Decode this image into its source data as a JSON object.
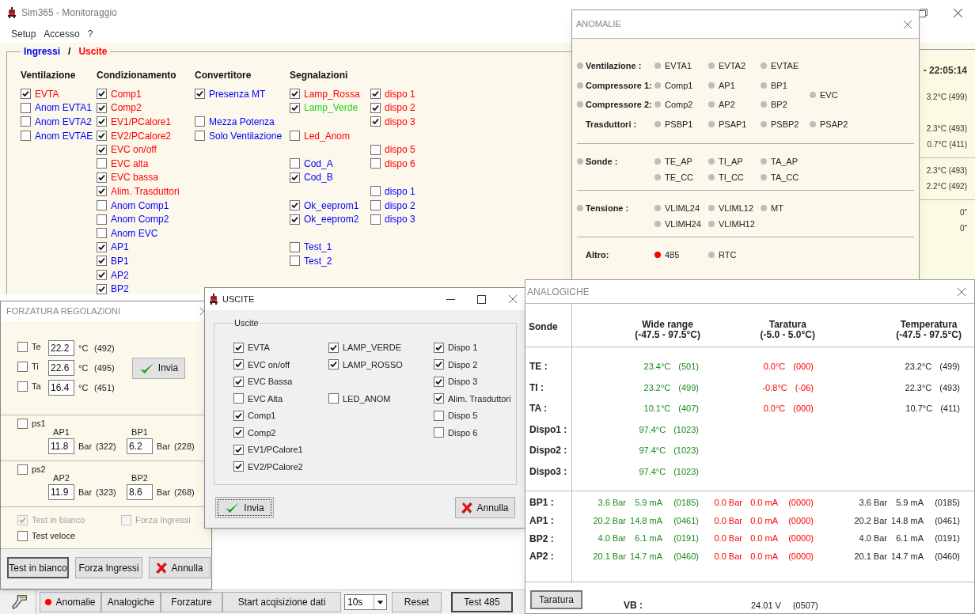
{
  "main": {
    "title": "Sim365 - Monitoraggio",
    "menu": [
      "Setup",
      "Accesso",
      "?"
    ],
    "legend": [
      {
        "label": "Ingressi",
        "color": "#0000ff"
      },
      {
        "label": "Uscite",
        "color": "#ff0000"
      }
    ],
    "legend_separator": "/",
    "groups": [
      {
        "title": "Ventilazione",
        "columns": [
          [
            {
              "kind": "check",
              "label": "EVTA",
              "checked": true,
              "color": "#ff0000"
            },
            {
              "kind": "check",
              "label": "Anom EVTA1",
              "checked": false,
              "color": "#0000ff"
            },
            {
              "kind": "check",
              "label": "Anom EVTA2",
              "checked": false,
              "color": "#0000ff"
            },
            {
              "kind": "check",
              "label": "Anom EVTAE",
              "checked": false,
              "color": "#0000ff"
            }
          ]
        ]
      },
      {
        "title": "Condizionamento",
        "columns": [
          [
            {
              "kind": "check",
              "label": "Comp1",
              "checked": true,
              "color": "#ff0000"
            },
            {
              "kind": "check",
              "label": "Comp2",
              "checked": true,
              "color": "#ff0000"
            },
            {
              "kind": "check",
              "label": "EV1/PCalore1",
              "checked": true,
              "color": "#ff0000"
            },
            {
              "kind": "check",
              "label": "EV2/PCalore2",
              "checked": true,
              "color": "#ff0000"
            },
            {
              "kind": "check",
              "label": "EVC on/off",
              "checked": true,
              "color": "#ff0000"
            },
            {
              "kind": "check",
              "label": "EVC alta",
              "checked": false,
              "color": "#ff0000"
            },
            {
              "kind": "check",
              "label": "EVC bassa",
              "checked": true,
              "color": "#ff0000"
            },
            {
              "kind": "check",
              "label": "Alim. Trasduttori",
              "checked": true,
              "color": "#ff0000"
            },
            {
              "kind": "check",
              "label": "Anom Comp1",
              "checked": false,
              "color": "#0000ff"
            },
            {
              "kind": "check",
              "label": "Anom Comp2",
              "checked": false,
              "color": "#0000ff"
            },
            {
              "kind": "check",
              "label": "Anom EVC",
              "checked": false,
              "color": "#0000ff"
            },
            {
              "kind": "check",
              "label": "AP1",
              "checked": true,
              "color": "#0000ff"
            },
            {
              "kind": "check",
              "label": "BP1",
              "checked": true,
              "color": "#0000ff"
            },
            {
              "kind": "check",
              "label": "AP2",
              "checked": true,
              "color": "#0000ff"
            },
            {
              "kind": "check",
              "label": "BP2",
              "checked": true,
              "color": "#0000ff"
            }
          ]
        ]
      },
      {
        "title": "Convertitore",
        "columns": [
          [
            {
              "kind": "check",
              "label": "Presenza MT",
              "checked": true,
              "color": "#0000ff"
            },
            {
              "kind": "gap"
            },
            {
              "kind": "check",
              "label": "Mezza Potenza",
              "checked": false,
              "color": "#0000ff"
            },
            {
              "kind": "check",
              "label": "Solo Ventilazione",
              "checked": false,
              "color": "#0000ff"
            }
          ]
        ]
      },
      {
        "title": "Segnalazioni",
        "columns": [
          [
            {
              "kind": "check",
              "label": "Lamp_Rossa",
              "checked": true,
              "color": "#ff0000"
            },
            {
              "kind": "check",
              "label": "Lamp_Verde",
              "checked": true,
              "color": "#19d219"
            },
            {
              "kind": "gap"
            },
            {
              "kind": "check",
              "label": "Led_Anom",
              "checked": false,
              "color": "#ff0000"
            },
            {
              "kind": "gap"
            },
            {
              "kind": "check",
              "label": "Cod_A",
              "checked": false,
              "color": "#0000ff"
            },
            {
              "kind": "check",
              "label": "Cod_B",
              "checked": true,
              "color": "#0000ff"
            },
            {
              "kind": "gap"
            },
            {
              "kind": "check",
              "label": "Ok_eeprom1",
              "checked": true,
              "color": "#0000ff"
            },
            {
              "kind": "check",
              "label": "Ok_eeprom2",
              "checked": true,
              "color": "#0000ff"
            },
            {
              "kind": "gap"
            },
            {
              "kind": "check",
              "label": "Test_1",
              "checked": false,
              "color": "#0000ff"
            },
            {
              "kind": "check",
              "label": "Test_2",
              "checked": false,
              "color": "#0000ff"
            }
          ],
          [
            {
              "kind": "check",
              "label": "dispo 1",
              "checked": true,
              "color": "#ff0000"
            },
            {
              "kind": "check",
              "label": "dispo 2",
              "checked": true,
              "color": "#ff0000"
            },
            {
              "kind": "check",
              "label": "dispo 3",
              "checked": true,
              "color": "#ff0000"
            },
            {
              "kind": "gap"
            },
            {
              "kind": "check",
              "label": "dispo 5",
              "checked": false,
              "color": "#ff0000"
            },
            {
              "kind": "check",
              "label": "dispo 6",
              "checked": false,
              "color": "#ff0000"
            },
            {
              "kind": "gap"
            },
            {
              "kind": "check",
              "label": "dispo 1",
              "checked": false,
              "color": "#0000ff"
            },
            {
              "kind": "check",
              "label": "dispo 2",
              "checked": false,
              "color": "#0000ff"
            },
            {
              "kind": "check",
              "label": "dispo 3",
              "checked": false,
              "color": "#0000ff"
            }
          ]
        ]
      }
    ],
    "side_readings": [
      [
        "- 22:05:14"
      ],
      [
        "3.2°C  (499)"
      ],
      [
        "2.3°C  (493)",
        "0.7°C  (411)"
      ],
      [
        "2.3°C  (493)",
        "2.2°C  (492)"
      ],
      [
        "0\"",
        "0\""
      ]
    ],
    "toolbar": [
      {
        "kind": "button",
        "label": "Anomalie",
        "alarm": true,
        "default": false
      },
      {
        "kind": "button",
        "label": "Analogiche",
        "alarm": false,
        "default": false
      },
      {
        "kind": "button",
        "label": "Forzature",
        "alarm": false,
        "default": false
      },
      {
        "kind": "button",
        "label": "Start acqisizione dati",
        "alarm": false,
        "default": false
      },
      {
        "kind": "select",
        "value": "10s"
      },
      {
        "kind": "button",
        "label": "Reset",
        "alarm": false,
        "default": false
      },
      {
        "kind": "button",
        "label": "Test 485",
        "alarm": false,
        "default": true
      }
    ]
  },
  "forzatura": {
    "title": "FORZATURA REGOLAZIONI",
    "temps": [
      {
        "label": "Te",
        "checked": false,
        "value": "22.2",
        "unit": "°C",
        "raw": "(492)"
      },
      {
        "label": "Ti",
        "checked": false,
        "value": "22.6",
        "unit": "°C",
        "raw": "(495)"
      },
      {
        "label": "Ta",
        "checked": false,
        "value": "16.4",
        "unit": "°C",
        "raw": "(451)"
      }
    ],
    "send_button": "Invia",
    "pressures": [
      {
        "label": "ps1",
        "checked": false,
        "fields": [
          {
            "caption": "AP1",
            "value": "11.8",
            "unit": "Bar",
            "raw": "(322)"
          },
          {
            "caption": "BP1",
            "value": "6.2",
            "unit": "Bar",
            "raw": "(228)"
          }
        ]
      },
      {
        "label": "ps2",
        "checked": false,
        "fields": [
          {
            "caption": "AP2",
            "value": "11.9",
            "unit": "Bar",
            "raw": "(323)"
          },
          {
            "caption": "BP2",
            "value": "8.6",
            "unit": "Bar",
            "raw": "(268)"
          }
        ]
      }
    ],
    "options": [
      {
        "label": "Test in bianco",
        "checked": true,
        "disabled": true
      },
      {
        "label": "Forza Ingressi",
        "checked": false,
        "disabled": true
      },
      {
        "label": "Test veloce",
        "checked": false,
        "disabled": false
      }
    ],
    "buttons": [
      {
        "label": "Test in bianco",
        "kind": "plain",
        "default": true
      },
      {
        "label": "Forza Ingressi",
        "kind": "plain",
        "default": false
      },
      {
        "label": "Annulla",
        "kind": "cancel",
        "default": false
      }
    ]
  },
  "uscite": {
    "title": "USCITE",
    "group_label": "Uscite",
    "columns": [
      [
        {
          "kind": "check",
          "label": "EVTA",
          "checked": true
        },
        {
          "kind": "check",
          "label": "EVC on/off",
          "checked": true
        },
        {
          "kind": "check",
          "label": "EVC Bassa",
          "checked": true
        },
        {
          "kind": "check",
          "label": "EVC Alta",
          "checked": false
        },
        {
          "kind": "check",
          "label": "Comp1",
          "checked": true
        },
        {
          "kind": "check",
          "label": "Comp2",
          "checked": true
        },
        {
          "kind": "check",
          "label": "EV1/PCalore1",
          "checked": true
        },
        {
          "kind": "check",
          "label": "EV2/PCalore2",
          "checked": true
        }
      ],
      [
        {
          "kind": "check",
          "label": "LAMP_VERDE",
          "checked": true
        },
        {
          "kind": "check",
          "label": "LAMP_ROSSO",
          "checked": true
        },
        {
          "kind": "gap"
        },
        {
          "kind": "check",
          "label": "LED_ANOM",
          "checked": false
        }
      ],
      [
        {
          "kind": "check",
          "label": "Dispo 1",
          "checked": true
        },
        {
          "kind": "check",
          "label": "Dispo 2",
          "checked": true
        },
        {
          "kind": "check",
          "label": "Dispo 3",
          "checked": true
        },
        {
          "kind": "check",
          "label": "Alim. Trasduttori",
          "checked": true
        },
        {
          "kind": "check",
          "label": "Dispo 5",
          "checked": false
        },
        {
          "kind": "check",
          "label": "Dispo 6",
          "checked": false
        }
      ]
    ],
    "buttons": [
      {
        "label": "Invia",
        "kind": "ok"
      },
      {
        "label": "Annulla",
        "kind": "cancel"
      }
    ]
  },
  "anomalie": {
    "title": "ANOMALIE",
    "sections": [
      {
        "rows": [
          {
            "label": "Ventilazione :",
            "led": true,
            "items": [
              {
                "label": "EVTA1",
                "alarm": false
              },
              {
                "label": "EVTA2",
                "alarm": false
              },
              {
                "label": "EVTAE",
                "alarm": false
              }
            ]
          },
          {
            "label": "Compressore 1:",
            "led": true,
            "items": [
              {
                "label": "Comp1",
                "alarm": false
              },
              {
                "label": "AP1",
                "alarm": false
              },
              {
                "label": "BP1",
                "alarm": false
              },
              {
                "label": "EVC",
                "alarm": false,
                "spans_rows": true
              }
            ]
          },
          {
            "label": "Compressore 2:",
            "led": true,
            "items": [
              {
                "label": "Comp2",
                "alarm": false
              },
              {
                "label": "AP2",
                "alarm": false
              },
              {
                "label": "BP2",
                "alarm": false
              }
            ]
          },
          {
            "label": "Trasduttori :",
            "led": false,
            "items": [
              {
                "label": "PSBP1",
                "alarm": false
              },
              {
                "label": "PSAP1",
                "alarm": false
              },
              {
                "label": "PSBP2",
                "alarm": false
              },
              {
                "label": "PSAP2",
                "alarm": false
              }
            ]
          }
        ]
      },
      {
        "rows": [
          {
            "label": "Sonde :",
            "led": true,
            "items": [
              {
                "label": "TE_AP",
                "alarm": false
              },
              {
                "label": "TI_AP",
                "alarm": false
              },
              {
                "label": "TA_AP",
                "alarm": false
              }
            ]
          },
          {
            "items": [
              {
                "label": "TE_CC",
                "alarm": false
              },
              {
                "label": "TI_CC",
                "alarm": false
              },
              {
                "label": "TA_CC",
                "alarm": false
              }
            ]
          }
        ]
      },
      {
        "rows": [
          {
            "label": "Tensione :",
            "led": true,
            "items": [
              {
                "label": "VLIML24",
                "alarm": false
              },
              {
                "label": "VLIML12",
                "alarm": false
              },
              {
                "label": "MT",
                "alarm": false
              }
            ]
          },
          {
            "items": [
              {
                "label": "VLIMH24",
                "alarm": false
              },
              {
                "label": "VLIMH12",
                "alarm": false
              }
            ]
          }
        ]
      },
      {
        "rows": [
          {
            "label": "Altro:",
            "led": false,
            "items": [
              {
                "label": "485",
                "alarm": true
              },
              {
                "label": "RTC",
                "alarm": false
              }
            ]
          }
        ]
      }
    ]
  },
  "analogiche": {
    "title": "ANALOGICHE",
    "label_header": "Sonde",
    "headers": [
      {
        "title": "Wide range",
        "range": "(-47.5 - 97.5°C)"
      },
      {
        "title": "Taratura",
        "range": "(-5.0 - 5.0°C)"
      },
      {
        "title": "Temperatura",
        "range": "(-47.5 - 97.5°C)"
      }
    ],
    "probes": [
      {
        "label": "TE :",
        "cells": [
          [
            "23.4°C",
            "(501)"
          ],
          [
            "0.0°C",
            "(000)"
          ],
          [
            "23.2°C",
            "(499)"
          ]
        ]
      },
      {
        "label": "TI :",
        "cells": [
          [
            "23.2°C",
            "(499)"
          ],
          [
            "-0.8°C",
            "(-06)"
          ],
          [
            "22.3°C",
            "(493)"
          ]
        ]
      },
      {
        "label": "TA :",
        "cells": [
          [
            "10.1°C",
            "(407)"
          ],
          [
            "0.0°C",
            "(000)"
          ],
          [
            "10.7°C",
            "(411)"
          ]
        ]
      },
      {
        "label": "Dispo1 :",
        "cells": [
          [
            "97.4°C",
            "(1023)"
          ]
        ]
      },
      {
        "label": "Dispo2 :",
        "cells": [
          [
            "97.4°C",
            "(1023)"
          ]
        ]
      },
      {
        "label": "Dispo3 :",
        "cells": [
          [
            "97.4°C",
            "(1023)"
          ]
        ]
      }
    ],
    "pressures": [
      {
        "label": "BP1 :",
        "cells": [
          [
            "3.6 Bar",
            "5.9 mA",
            "(0185)"
          ],
          [
            "0.0 Bar",
            "0.0 mA",
            "(0000)"
          ],
          [
            "3.6 Bar",
            "5.9 mA",
            "(0185)"
          ]
        ]
      },
      {
        "label": "AP1 :",
        "cells": [
          [
            "20.2 Bar",
            "14.8 mA",
            "(0461)"
          ],
          [
            "0.0 Bar",
            "0.0 mA",
            "(0000)"
          ],
          [
            "20.2 Bar",
            "14.8 mA",
            "(0461)"
          ]
        ]
      },
      {
        "label": "BP2 :",
        "cells": [
          [
            "4.0 Bar",
            "6.1 mA",
            "(0191)"
          ],
          [
            "0.0 Bar",
            "0.0 mA",
            "(0000)"
          ],
          [
            "4.0 Bar",
            "6.1 mA",
            "(0191)"
          ]
        ]
      },
      {
        "label": "AP2 :",
        "cells": [
          [
            "20.1 Bar",
            "14.7 mA",
            "(0460)"
          ],
          [
            "0.0 Bar",
            "0.0 mA",
            "(0000)"
          ],
          [
            "20.1 Bar",
            "14.7 mA",
            "(0460)"
          ]
        ]
      }
    ],
    "calibrate_button": "Taratura",
    "vb": {
      "label": "VB :",
      "value": "24.01 V",
      "raw": "(0507)"
    }
  }
}
